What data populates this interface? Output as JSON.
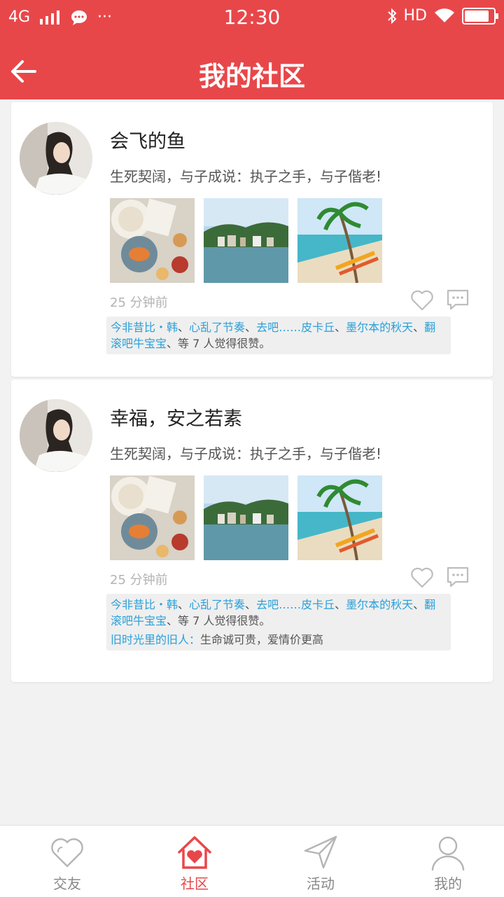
{
  "status_bar": {
    "network": "4G",
    "time": "12:30",
    "hd": "HD",
    "dots": "···"
  },
  "header": {
    "title": "我的社区"
  },
  "posts": [
    {
      "name": "会飞的鱼",
      "desc": "生死契阔，与子成说：执子之手，与子偕老!",
      "time": "25 分钟前",
      "likers": [
        "今非昔比・韩",
        "心乱了节奏",
        "去吧……皮卡丘",
        "墨尔本的秋天",
        "翻滚吧牛宝宝"
      ],
      "likes_suffix": "等 7 人觉得很赞。"
    },
    {
      "name": "幸福，安之若素",
      "desc": "生死契阔，与子成说：执子之手，与子偕老!",
      "time": "25 分钟前",
      "likers": [
        "今非昔比・韩",
        "心乱了节奏",
        "去吧……皮卡丘",
        "墨尔本的秋天",
        "翻滚吧牛宝宝"
      ],
      "likes_suffix": "等 7 人觉得很赞。",
      "comment_user": "旧时光里的旧人：",
      "comment_text": "生命诚可贵，爱情价更高"
    }
  ],
  "tabs": [
    {
      "label": "交友",
      "icon": "heart-outline-icon"
    },
    {
      "label": "社区",
      "icon": "home-heart-icon",
      "active": true
    },
    {
      "label": "活动",
      "icon": "send-icon"
    },
    {
      "label": "我的",
      "icon": "user-icon"
    }
  ],
  "colors": {
    "accent": "#e8474a",
    "link": "#2aa0d9"
  }
}
